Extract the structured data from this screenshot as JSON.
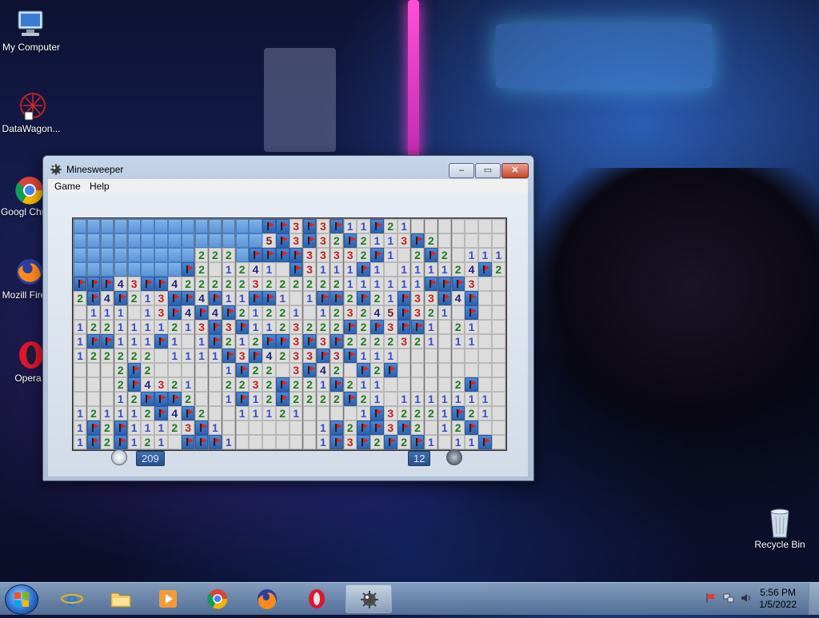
{
  "desktop": {
    "icons": [
      {
        "label": "My Computer",
        "icon": "computer-icon"
      },
      {
        "label": "DataWagon...",
        "icon": "datawagon-icon"
      },
      {
        "label": "Googl Chron",
        "icon": "chrome-icon"
      },
      {
        "label": "Mozill Firefo",
        "icon": "firefox-icon"
      },
      {
        "label": "Opera",
        "icon": "opera-icon"
      },
      {
        "label": "Recycle Bin",
        "icon": "recycle-bin-icon"
      }
    ]
  },
  "window": {
    "title": "Minesweeper",
    "controls": {
      "minimize": "–",
      "maximize": "▭",
      "close": "✕"
    },
    "menu": [
      "Game",
      "Help"
    ]
  },
  "game": {
    "time": "209",
    "mines_left": "12",
    "board": [
      "UUUUUUUUUUUUUUFF3F3F11F21.......",
      "UUUUUUUUUUUUUU5F3F32F2113F2.....",
      "UUUUUUUUU222UFFFF33332F1.2F2.111",
      "UUUUUUUUF2.1241.F3111F1.111124F2",
      "FFF43FF4222223222222111111FFF3..",
      "2F4F213FF4F11FF1.1FF2F21F33F4F..",
      ".111.13F4F4F21221.123245F321.F..",
      "1221111213F3F1123222F2F3FF1.21..",
      "1FF111F1.1F212FF3F3F2222321.11..",
      "122222.1111F3F4233F3F111........",
      "...2F2.....1F22.3F42.F2F........",
      "...2F4321..2232F221F211.....2F..",
      "...12FFF2..1F12F2222F21.1111111.",
      "121112F4F2..11121....1F32221F21.",
      "1F2F11123F1.......1F2FF3F2.12F..",
      "1F2F121.FFF1......1F3F2F2F1.11F."
    ],
    "cols": 32
  },
  "taskbar": {
    "items": [
      {
        "icon": "internet-explorer-icon"
      },
      {
        "icon": "file-explorer-icon"
      },
      {
        "icon": "media-player-icon"
      },
      {
        "icon": "chrome-icon"
      },
      {
        "icon": "firefox-icon"
      },
      {
        "icon": "opera-icon"
      },
      {
        "icon": "minesweeper-icon",
        "active": true
      }
    ],
    "tray_icons": [
      "flag-icon",
      "network-icon",
      "volume-icon"
    ],
    "time": "5:56 PM",
    "date": "1/5/2022"
  },
  "colors": {
    "unrevealed": "#5d94d6",
    "revealed": "#dcdcdc",
    "num1": "#3a4ec8",
    "num2": "#1f7a1f",
    "num3": "#c3211c",
    "num4": "#22237a",
    "num5": "#7a1a1a"
  }
}
